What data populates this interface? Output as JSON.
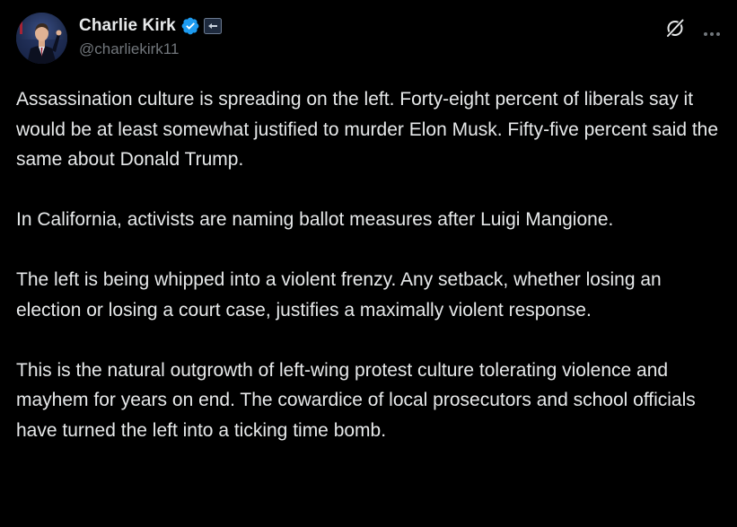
{
  "author": {
    "display_name": "Charlie Kirk",
    "handle": "@charliekirk11",
    "verified": true
  },
  "icons": {
    "verified": "verified-badge-icon",
    "affiliation": "affiliation-badge-icon",
    "grok": "grok-icon",
    "more": "more-options-icon"
  },
  "colors": {
    "background": "#000000",
    "text": "#e7e9ea",
    "secondary_text": "#71767b",
    "verified_blue": "#1d9bf0"
  },
  "post": {
    "paragraphs": [
      "Assassination culture is spreading on the left. Forty-eight percent of liberals say it would be at least somewhat justified to murder Elon Musk. Fifty-five percent said the same about Donald Trump.",
      "In California, activists are naming ballot measures after Luigi Mangione.",
      "The left is being whipped into a violent frenzy. Any setback, whether losing an election or losing a court case, justifies a maximally violent response.",
      "This is the natural outgrowth of left-wing protest culture tolerating violence and mayhem for years on end. The cowardice of local prosecutors and school officials have turned the left into a ticking time bomb."
    ]
  }
}
